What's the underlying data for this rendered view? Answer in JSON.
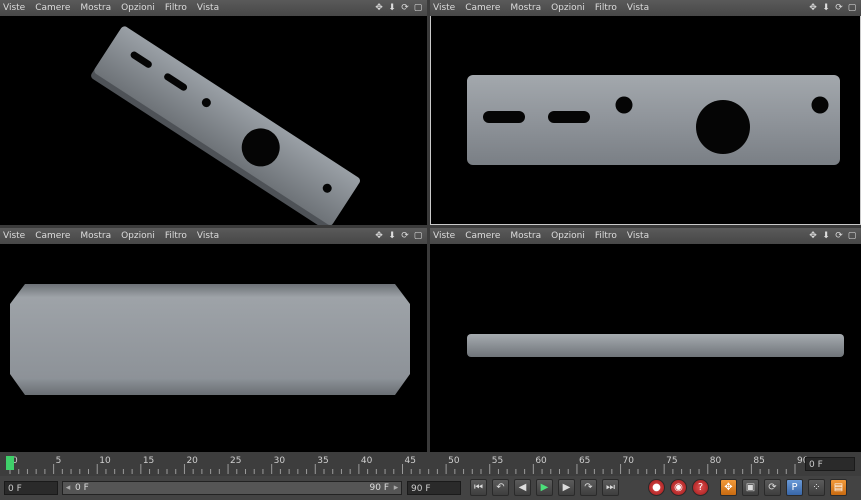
{
  "viewport_menu": [
    "Viste",
    "Camere",
    "Mostra",
    "Opzioni",
    "Filtro",
    "Vista"
  ],
  "viewport_icons": [
    "move-icon",
    "arrow-down-icon",
    "rotate-icon",
    "maximize-icon"
  ],
  "viewport_icon_glyphs": [
    "✥",
    "⬇",
    "⟳",
    "▢"
  ],
  "timeline": {
    "ticks": [
      "0",
      "5",
      "10",
      "15",
      "20",
      "25",
      "30",
      "35",
      "40",
      "45",
      "50",
      "55",
      "60",
      "65",
      "70",
      "75",
      "80",
      "85",
      "90"
    ],
    "current_frame": "0 F",
    "start_field": "0 F",
    "range_start": "0 F",
    "range_end": "90 F",
    "end_field": "90 F"
  },
  "transport_buttons": [
    {
      "name": "go-to-start-button",
      "glyph": "⏮"
    },
    {
      "name": "prev-key-button",
      "glyph": "↶"
    },
    {
      "name": "prev-frame-button",
      "glyph": "◀"
    },
    {
      "name": "play-button",
      "glyph": "▶"
    },
    {
      "name": "next-frame-button",
      "glyph": "▶"
    },
    {
      "name": "next-key-button",
      "glyph": "↷"
    },
    {
      "name": "go-to-end-button",
      "glyph": "⏭"
    }
  ],
  "key_buttons": [
    {
      "name": "record-button",
      "glyph": "●"
    },
    {
      "name": "autokey-button",
      "glyph": "◉"
    },
    {
      "name": "keyframe-selection-button",
      "glyph": "?"
    }
  ],
  "key_mode_buttons": [
    {
      "name": "position-key-button",
      "glyph": "✥"
    },
    {
      "name": "scale-key-button",
      "glyph": "▣"
    },
    {
      "name": "rotation-key-button",
      "glyph": "⟳"
    },
    {
      "name": "parameter-key-button",
      "glyph": "P"
    },
    {
      "name": "point-level-button",
      "glyph": "⁘"
    },
    {
      "name": "timeline-window-button",
      "glyph": "▤"
    }
  ]
}
